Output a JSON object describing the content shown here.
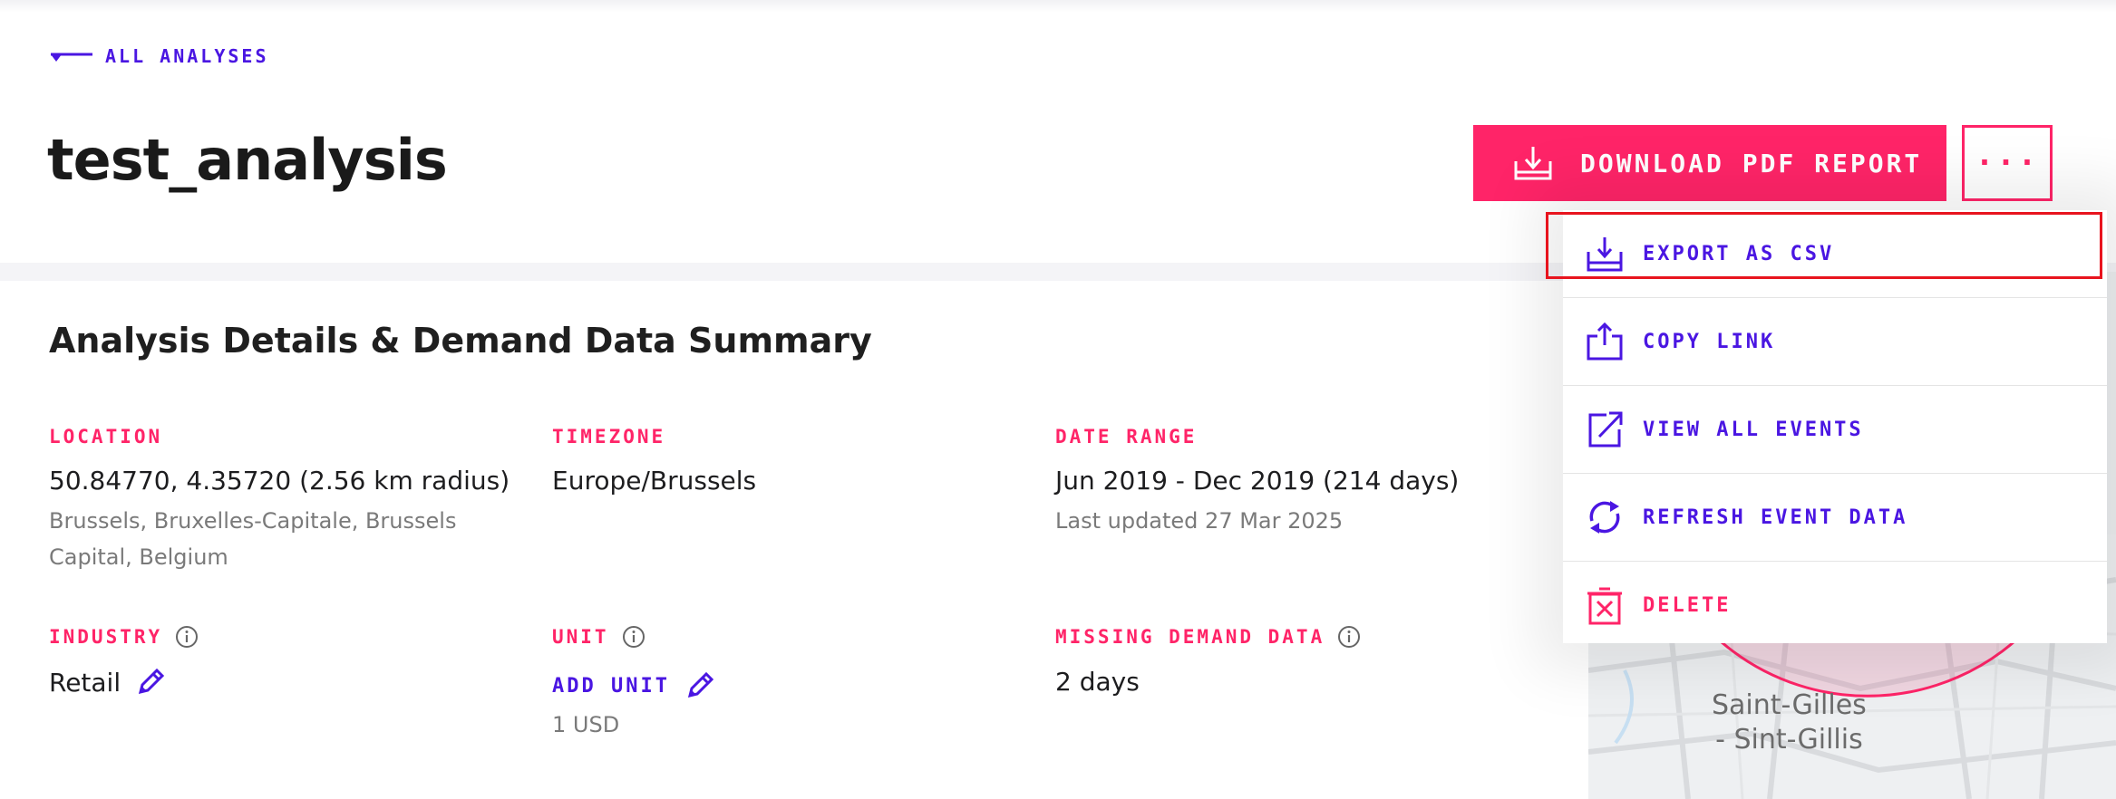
{
  "nav": {
    "back_label": "ALL ANALYSES"
  },
  "page": {
    "title": "test_analysis"
  },
  "actions": {
    "download_label": "DOWNLOAD PDF REPORT",
    "more_label": "···"
  },
  "menu": {
    "items": [
      {
        "label": "EXPORT AS CSV",
        "icon": "download-tray-icon"
      },
      {
        "label": "COPY LINK",
        "icon": "share-icon"
      },
      {
        "label": "VIEW ALL EVENTS",
        "icon": "external-link-icon"
      },
      {
        "label": "REFRESH EVENT DATA",
        "icon": "refresh-icon"
      },
      {
        "label": "DELETE",
        "icon": "delete-icon"
      }
    ]
  },
  "details": {
    "section_title": "Analysis Details & Demand Data Summary",
    "location": {
      "label": "LOCATION",
      "value": "50.84770, 4.35720 (2.56 km radius)",
      "sub_line1": "Brussels, Bruxelles-Capitale, Brussels",
      "sub_line2": "Capital, Belgium"
    },
    "timezone": {
      "label": "TIMEZONE",
      "value": "Europe/Brussels"
    },
    "date_range": {
      "label": "DATE RANGE",
      "value": "Jun 2019 - Dec 2019 (214 days)",
      "sub": "Last updated 27 Mar 2025"
    },
    "industry": {
      "label": "INDUSTRY",
      "value": "Retail"
    },
    "unit": {
      "label": "UNIT",
      "add_label": "ADD UNIT",
      "sub": "1 USD"
    },
    "missing": {
      "label": "MISSING DEMAND DATA",
      "value": "2 days"
    }
  },
  "map": {
    "place_line1": "Saint-Gilles",
    "place_line2": "- Sint-Gillis"
  },
  "colors": {
    "accent": "#4a16e2",
    "brand": "#ff2468",
    "highlight": "#e8141e"
  }
}
